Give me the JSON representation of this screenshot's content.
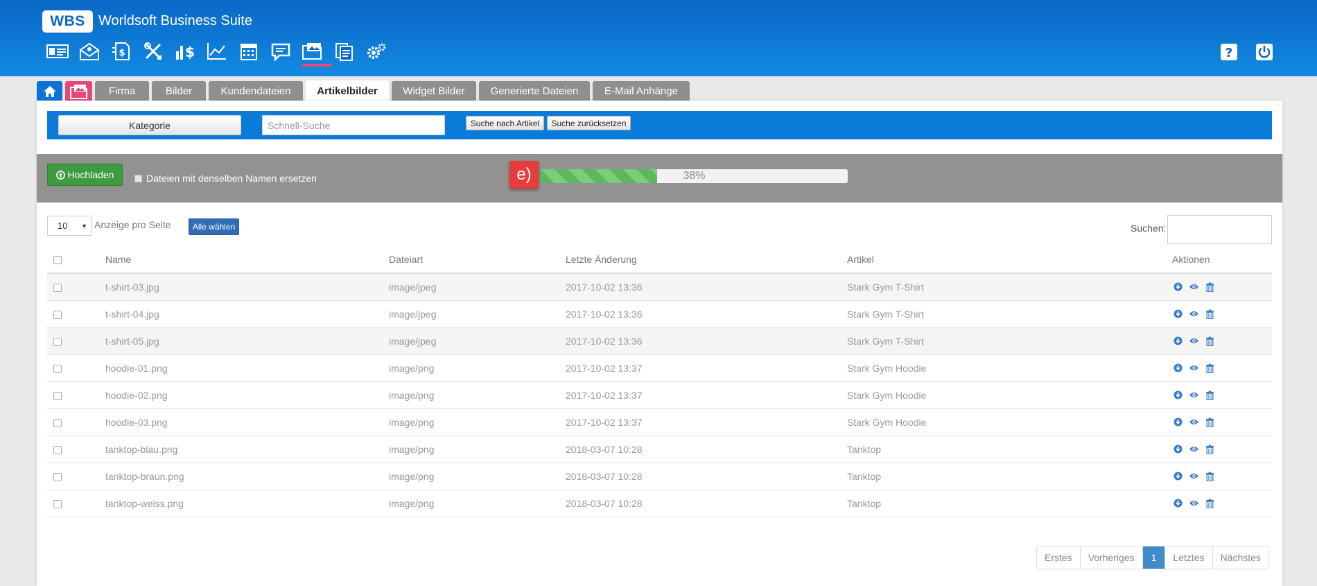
{
  "header": {
    "logo": "WBS",
    "title": "Worldsoft Business Suite",
    "nav_icons": [
      "contact-card-icon",
      "mail-icon",
      "document-dollar-icon",
      "tools-icon",
      "finance-icon",
      "chart-icon",
      "calendar-icon",
      "chat-icon",
      "folder-images-icon",
      "documents-icon",
      "settings-icon"
    ],
    "active_nav": "folder-images-icon"
  },
  "tabs": {
    "items": [
      "Firma",
      "Bilder",
      "Kundendateien",
      "Artikelbilder",
      "Widget Bilder",
      "Generierte Dateien",
      "E-Mail Anhänge"
    ],
    "active": "Artikelbilder"
  },
  "filter": {
    "kategorie_label": "Kategorie",
    "quick_search_placeholder": "Schnell-Suche",
    "search_article_label": "Suche nach Artikel",
    "reset_search_label": "Suche zurücksetzen"
  },
  "upload": {
    "button_label": "Hochladen",
    "replace_label": "Dateien mit denselben Namen ersetzen",
    "step_badge": "e)",
    "progress_percent": 38,
    "progress_label": "38%"
  },
  "list": {
    "per_page_value": "10",
    "per_page_label": "Anzeige pro Seite",
    "select_all_label": "Alle wählen",
    "search_label": "Suchen:",
    "columns": [
      "Name",
      "Dateiart",
      "Letzte Änderung",
      "Artikel",
      "Aktionen"
    ],
    "rows": [
      {
        "name": "t-shirt-03.jpg",
        "type": "image/jpeg",
        "modified": "2017-10-02 13:36",
        "article": "Stark Gym T-Shirt"
      },
      {
        "name": "t-shirt-04.jpg",
        "type": "image/jpeg",
        "modified": "2017-10-02 13:36",
        "article": "Stark Gym T-Shirt"
      },
      {
        "name": "t-shirt-05.jpg",
        "type": "image/jpeg",
        "modified": "2017-10-02 13:36",
        "article": "Stark Gym T-Shirt"
      },
      {
        "name": "hoodie-01.png",
        "type": "image/png",
        "modified": "2017-10-02 13:37",
        "article": "Stark Gym Hoodie"
      },
      {
        "name": "hoodie-02.png",
        "type": "image/png",
        "modified": "2017-10-02 13:37",
        "article": "Stark Gym Hoodie"
      },
      {
        "name": "hoodie-03.png",
        "type": "image/png",
        "modified": "2017-10-02 13:37",
        "article": "Stark Gym Hoodie"
      },
      {
        "name": "tanktop-blau.png",
        "type": "image/png",
        "modified": "2018-03-07 10:28",
        "article": "Tanktop"
      },
      {
        "name": "tanktop-braun.png",
        "type": "image/png",
        "modified": "2018-03-07 10:28",
        "article": "Tanktop"
      },
      {
        "name": "tanktop-weiss.png",
        "type": "image/png",
        "modified": "2018-03-07 10:28",
        "article": "Tanktop"
      }
    ]
  },
  "pagination": {
    "first": "Erstes",
    "prev": "Vorheriges",
    "current": "1",
    "last": "Letztes",
    "next": "Nächstes"
  },
  "colors": {
    "header": "#0a67c6",
    "accent_pink": "#e5487a",
    "filter_bar": "#0a7bd8",
    "upload_bar": "#929292",
    "upload_button": "#3f9b3f",
    "badge_red": "#e63c3c",
    "action_blue": "#3a7dc1"
  }
}
